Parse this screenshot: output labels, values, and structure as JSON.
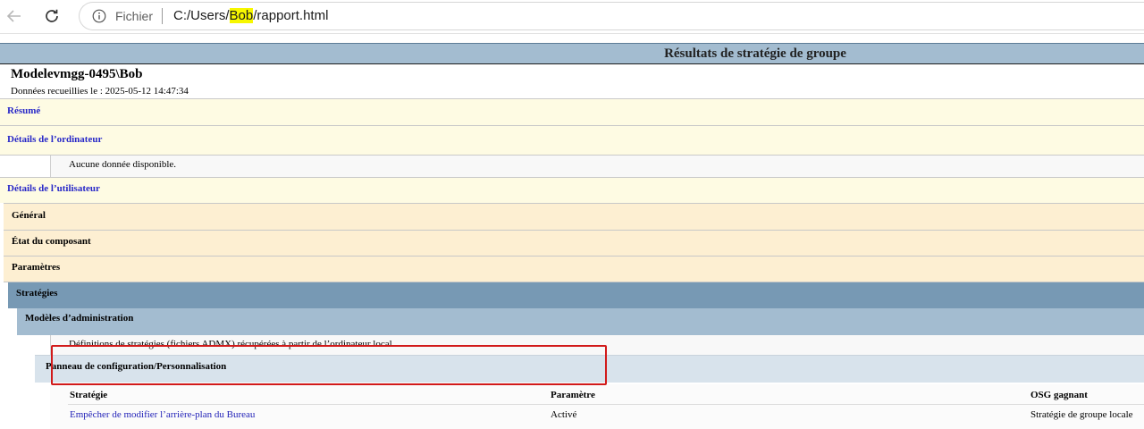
{
  "browser": {
    "scheme_label": "Fichier",
    "url_prefix": "C:/Users/",
    "url_highlight": "Bob",
    "url_suffix": "/rapport.html",
    "highlight_color": "#f7f700"
  },
  "report": {
    "title": "Résultats de stratégie de groupe",
    "host": "Modelevmgg-0495\\Bob",
    "collected": "Données recueillies le : 2025-05-12 14:47:34",
    "sections": {
      "resume": "Résumé",
      "computer_details": "Détails de l’ordinateur",
      "no_data": "Aucune donnée disponible.",
      "user_details": "Détails de l’utilisateur",
      "general": "Général",
      "component_state": "État du composant",
      "parameters": "Paramètres",
      "strategies": "Stratégies",
      "admin_templates": "Modèles d’administration",
      "admx_note": "Définitions de stratégies (fichiers ADMX) récupérées à partir de l’ordinateur local.",
      "control_panel": "Panneau de configuration/Personnalisation"
    },
    "table": {
      "headers": [
        "Stratégie",
        "Paramètre",
        "OSG gagnant"
      ],
      "rows": [
        {
          "policy": "Empêcher de modifier l’arrière-plan du Bureau",
          "setting": "Activé",
          "winning_gpo": "Stratégie de groupe locale"
        }
      ]
    }
  }
}
